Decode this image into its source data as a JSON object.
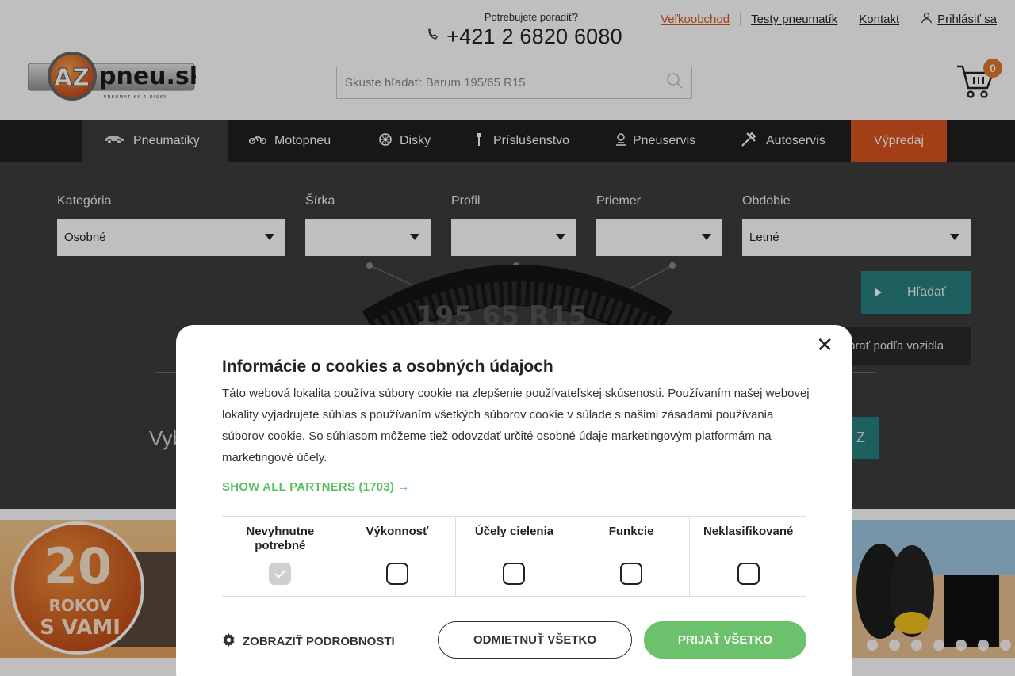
{
  "header": {
    "phone_question": "Potrebujete poradiť?",
    "phone_number": "+421 2 6820 6080",
    "links": [
      "Veľkoobchod",
      "Testy pneumatík",
      "Kontakt",
      "Prihlásiť sa"
    ],
    "logo_text": "pneu.sk",
    "logo_badge": "AZ",
    "logo_tagline": "PNEUMATIKY A DISKY",
    "search_placeholder": "Skúste hľadať: Barum 195/65 R15",
    "cart_count": "0"
  },
  "nav": {
    "items": [
      "Pneumatiky",
      "Motopneu",
      "Disky",
      "Príslušenstvo",
      "Pneuservis",
      "Autoservis",
      "Výpredaj"
    ],
    "active": "Pneumatiky"
  },
  "filter": {
    "labels": [
      "Kategória",
      "Šírka",
      "Profil",
      "Priemer",
      "Obdobie"
    ],
    "values": [
      "Osobné",
      "",
      "",
      "",
      "Letné"
    ],
    "tyre_text": "195 65 R15",
    "search_button": "Hľadať",
    "vehicle_button": "brať podľa vozidla",
    "partial_text": "Vyb",
    "partial_button": "Z"
  },
  "banner": {
    "badge_number": "20",
    "badge_line1": "ROKOV",
    "badge_line2": "S VAMI"
  },
  "cookie_modal": {
    "title": "Informácie o cookies a osobných údajoch",
    "text": "Táto webová lokalita používa súbory cookie na zlepšenie používateľskej skúsenosti. Používaním našej webovej lokality vyjadrujete súhlas s používaním všetkých súborov cookie v súlade s našimi zásadami používania súborov cookie. So súhlasom môžeme tiež odovzdať určité osobné údaje marketingovým platformám na marketingové účely.",
    "partners_link": "SHOW ALL PARTNERS (1703) →",
    "categories": [
      {
        "label": "Nevyhnutne potrebné",
        "checked": true
      },
      {
        "label": "Výkonnosť",
        "checked": false
      },
      {
        "label": "Účely cielenia",
        "checked": false
      },
      {
        "label": "Funkcie",
        "checked": false
      },
      {
        "label": "Neklasifikované",
        "checked": false
      }
    ],
    "details_label": "ZOBRAZIŤ PODROBNOSTI",
    "decline_label": "ODMIETNUŤ VŠETKO",
    "accept_label": "PRIJAŤ VŠETKO",
    "accent_color": "#6cc16c"
  },
  "colors": {
    "brand_orange": "#d9541e",
    "teal": "#28807f",
    "nav_bg": "#1f1f1f",
    "filter_bg": "#3d3d3d"
  }
}
